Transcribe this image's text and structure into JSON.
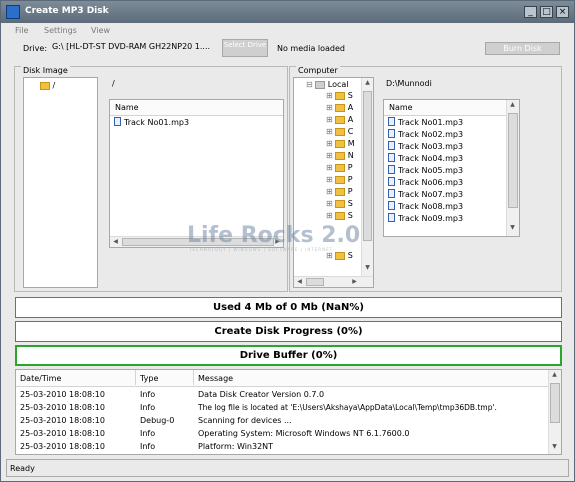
{
  "window": {
    "title": "Create MP3 Disk",
    "controls": [
      "_",
      "□",
      "×"
    ]
  },
  "menu": [
    "File",
    "Settings",
    "View"
  ],
  "drive": {
    "label": "Drive:",
    "value": "G:\\ [HL-DT-ST DVD-RAM GH22NP20 1....",
    "select_button": "Select Drive",
    "media_status": "No media loaded",
    "burn_button": "Burn Disk"
  },
  "disk_image": {
    "title": "Disk Image",
    "tree_root": "/",
    "path": "/",
    "column_name": "Name",
    "files": [
      "Track No01.mp3"
    ]
  },
  "computer": {
    "title": "Computer",
    "tree_root": "Local",
    "tree_items": [
      "S",
      "A",
      "A",
      "C",
      "M",
      "N",
      "P",
      "P",
      "P",
      "S",
      "S",
      "S"
    ],
    "path": "D:\\Munnodi",
    "column_name": "Name",
    "files": [
      "Track No01.mp3",
      "Track No02.mp3",
      "Track No03.mp3",
      "Track No04.mp3",
      "Track No05.mp3",
      "Track No06.mp3",
      "Track No07.mp3",
      "Track No08.mp3",
      "Track No09.mp3"
    ]
  },
  "progress": {
    "used": "Used 4 Mb of 0 Mb (NaN%)",
    "create": "Create Disk Progress (0%)",
    "buffer": "Drive Buffer (0%)"
  },
  "log": {
    "columns": [
      "Date/Time",
      "Type",
      "Message"
    ],
    "rows": [
      [
        "25-03-2010 18:08:10",
        "Info",
        "Data Disk Creator Version 0.7.0"
      ],
      [
        "25-03-2010 18:08:10",
        "Info",
        "The log file is located at 'E:\\Users\\Akshaya\\AppData\\Local\\Temp\\tmp36DB.tmp'."
      ],
      [
        "25-03-2010 18:08:10",
        "Debug-0",
        "Scanning for devices ..."
      ],
      [
        "25-03-2010 18:08:10",
        "Info",
        "Operating System: Microsoft Windows NT 6.1.7600.0"
      ],
      [
        "25-03-2010 18:08:10",
        "Info",
        "Platform: Win32NT"
      ]
    ]
  },
  "status_text": "Ready",
  "watermark": {
    "text": "Life Rocks 2.0",
    "subtext": "TECHNOLOGY | WINDOWS | SOFTWARE | INTERNET"
  },
  "colors": {
    "titlebar": "#6b7a87",
    "buffer_border": "#27a82b",
    "mp3_icon": "#3461a8",
    "folder": "#f0c040"
  }
}
